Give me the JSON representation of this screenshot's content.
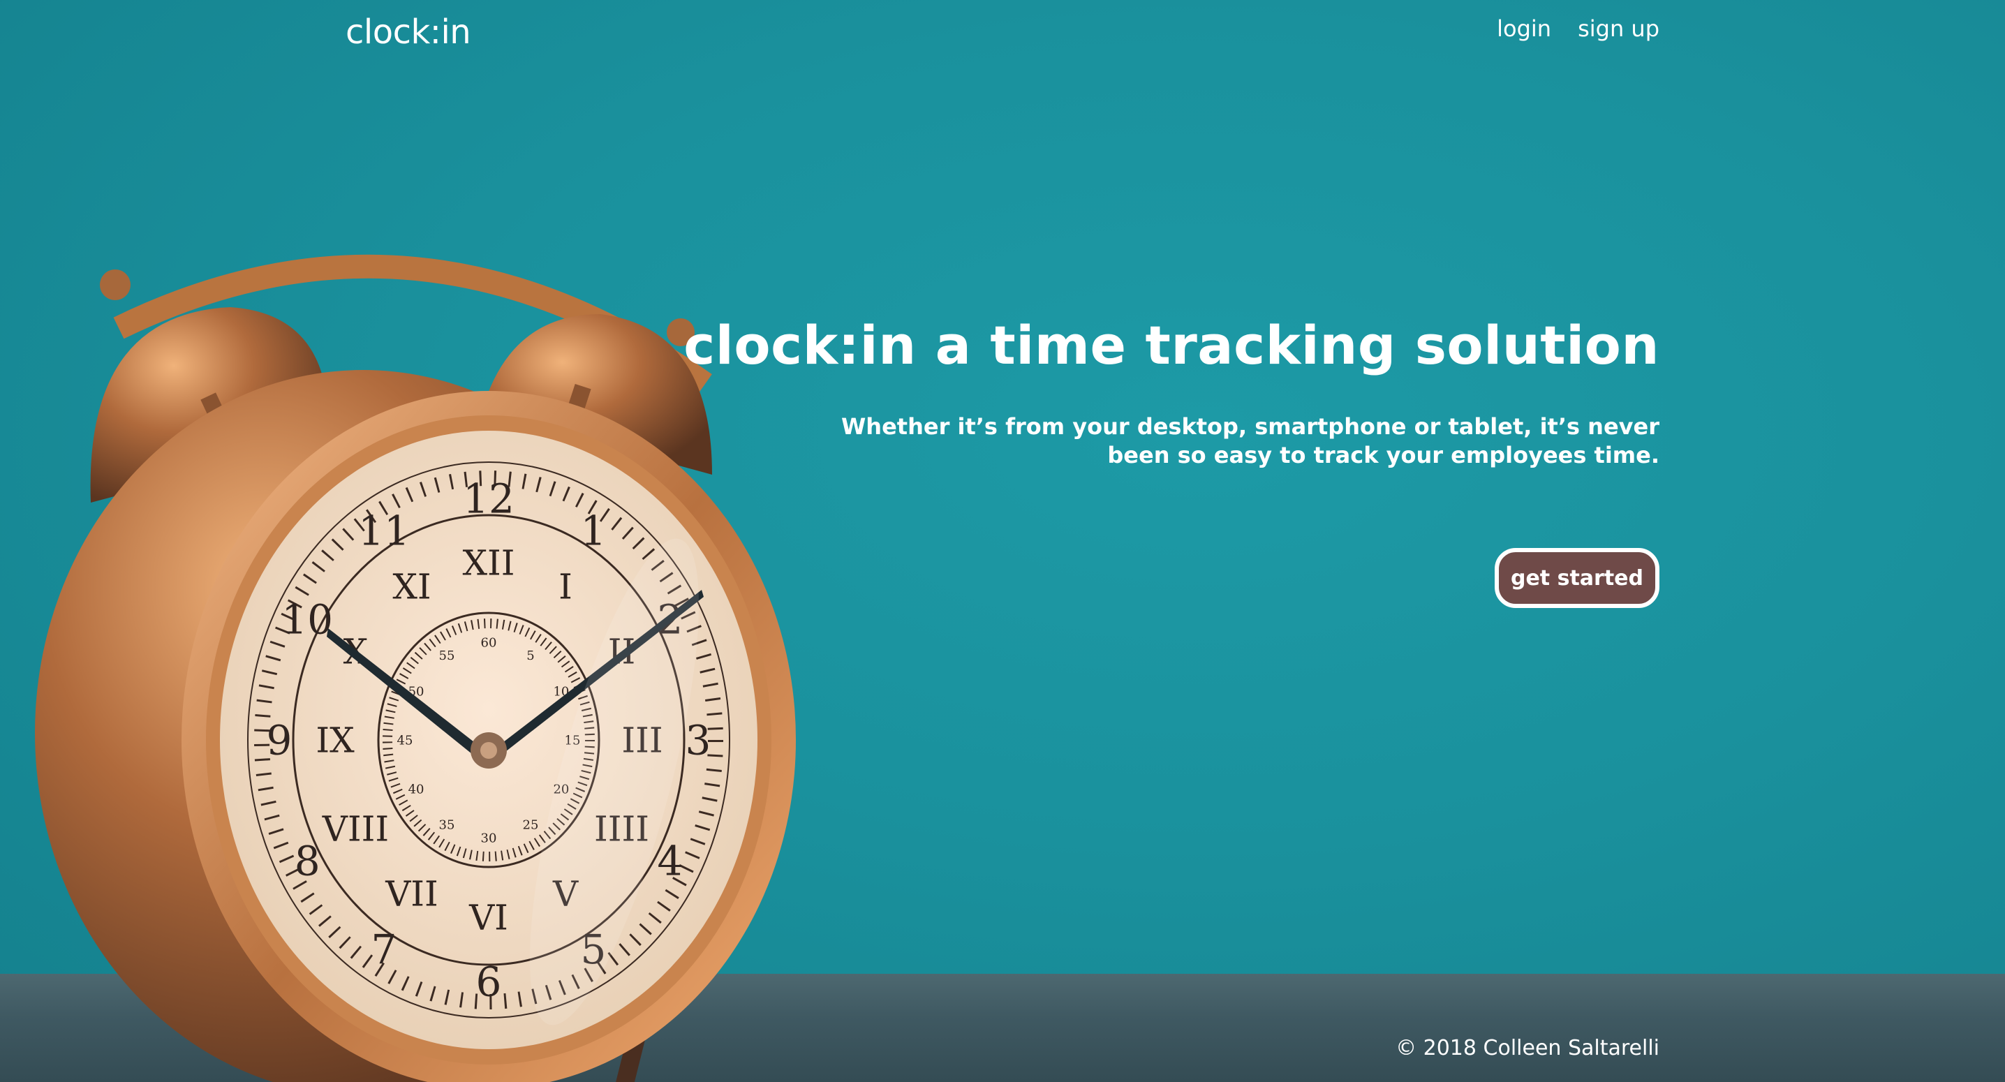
{
  "nav": {
    "brand": "clock:in",
    "login_label": "login",
    "signup_label": "sign up"
  },
  "hero": {
    "title": "clock:in a time tracking solution",
    "subtitle": "Whether it’s from your desktop, smartphone or tablet, it’s never been so easy to track your employees time.",
    "cta_label": "get started"
  },
  "footer": {
    "copyright": "© 2018 Colleen Saltarelli"
  },
  "colors": {
    "background": "#1a919d",
    "button_fill": "#6f4a48",
    "button_border": "#ffffff",
    "text": "#ffffff"
  },
  "clock_numerals": [
    "12",
    "1",
    "2",
    "3",
    "4",
    "5",
    "6",
    "7",
    "8",
    "9",
    "10",
    "11"
  ],
  "clock_inner_minutes": [
    "60",
    "5",
    "10",
    "15",
    "20",
    "25",
    "30",
    "35",
    "40",
    "45",
    "50",
    "55"
  ],
  "clock_roman_numerals": [
    "XII",
    "I",
    "II",
    "III",
    "IIII",
    "V",
    "VI",
    "VII",
    "VIII",
    "IX",
    "X",
    "XI"
  ]
}
